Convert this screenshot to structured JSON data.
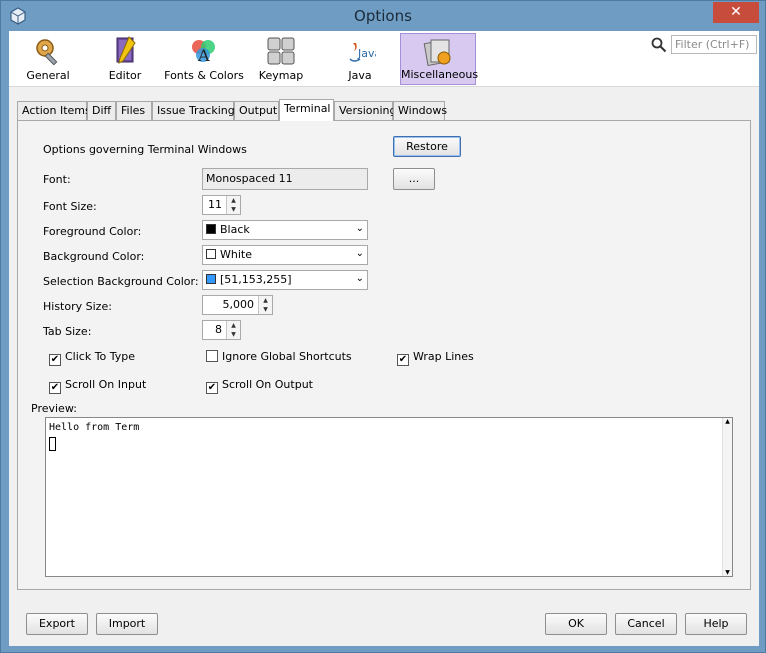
{
  "window": {
    "title": "Options",
    "close_label": "✕"
  },
  "categories": [
    {
      "label": "General",
      "icon": "gear-wrench-icon"
    },
    {
      "label": "Editor",
      "icon": "editor-book-icon"
    },
    {
      "label": "Fonts & Colors",
      "icon": "fonts-colors-icon"
    },
    {
      "label": "Keymap",
      "icon": "keyboard-icon"
    },
    {
      "label": "Java",
      "icon": "java-icon"
    },
    {
      "label": "Miscellaneous",
      "icon": "misc-icon"
    }
  ],
  "java_word": "Java",
  "search": {
    "placeholder": "Filter (Ctrl+F)"
  },
  "tabs": [
    {
      "label": "Action Items"
    },
    {
      "label": "Diff"
    },
    {
      "label": "Files"
    },
    {
      "label": "Issue Tracking"
    },
    {
      "label": "Output"
    },
    {
      "label": "Terminal"
    },
    {
      "label": "Versioning"
    },
    {
      "label": "Windows"
    }
  ],
  "terminal": {
    "heading": "Options governing Terminal Windows",
    "restore_label": "Restore",
    "font_label": "Font:",
    "font_value": "Monospaced 11",
    "font_browse_label": "...",
    "font_size_label": "Font Size:",
    "font_size_value": "11",
    "foreground_label": "Foreground Color:",
    "foreground_value": "Black",
    "foreground_color": "#000000",
    "background_label": "Background Color:",
    "background_value": "White",
    "background_color": "#ffffff",
    "selection_label": "Selection Background Color:",
    "selection_value": "[51,153,255]",
    "selection_color": "#3399ff",
    "history_label": "History Size:",
    "history_value": "5,000",
    "tab_size_label": "Tab Size:",
    "tab_size_value": "8",
    "click_to_type": {
      "label": "Click To Type",
      "checked": true
    },
    "ignore_shortcuts": {
      "label": "Ignore Global Shortcuts",
      "checked": false
    },
    "wrap_lines": {
      "label": "Wrap Lines",
      "checked": true
    },
    "scroll_on_input": {
      "label": "Scroll On Input",
      "checked": true
    },
    "scroll_on_output": {
      "label": "Scroll On Output",
      "checked": true
    },
    "preview_label": "Preview:",
    "preview_text": "Hello from Term"
  },
  "footer": {
    "export_label": "Export",
    "import_label": "Import",
    "ok_label": "OK",
    "cancel_label": "Cancel",
    "help_label": "Help"
  },
  "check_glyph": "✔"
}
